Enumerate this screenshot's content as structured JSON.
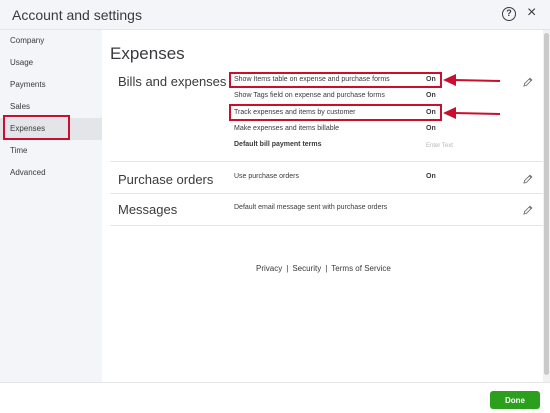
{
  "window": {
    "title": "Account and settings",
    "help_glyph": "?",
    "close_glyph": "×"
  },
  "sidebar": {
    "items": [
      {
        "label": "Company"
      },
      {
        "label": "Usage"
      },
      {
        "label": "Payments"
      },
      {
        "label": "Sales"
      },
      {
        "label": "Expenses"
      },
      {
        "label": "Time"
      },
      {
        "label": "Advanced"
      }
    ],
    "active": "Expenses"
  },
  "main": {
    "page_title": "Expenses",
    "bills": {
      "title": "Bills and expenses",
      "rows": [
        {
          "label": "Show Items table on expense and purchase forms",
          "value": "On"
        },
        {
          "label": "Show Tags field on expense and purchase forms",
          "value": "On"
        },
        {
          "label": "Track expenses and items by customer",
          "value": "On"
        },
        {
          "label": "Make expenses and items billable",
          "value": "On"
        },
        {
          "label": "Default bill payment terms",
          "placeholder": "Enter Text"
        }
      ]
    },
    "purchase_orders": {
      "title": "Purchase orders",
      "rows": [
        {
          "label": "Use purchase orders",
          "value": "On"
        }
      ]
    },
    "messages": {
      "title": "Messages",
      "rows": [
        {
          "label": "Default email message sent with purchase orders"
        }
      ]
    }
  },
  "footer": {
    "links": [
      "Privacy",
      "Security",
      "Terms of Service"
    ],
    "separator": "|"
  },
  "actions": {
    "done_label": "Done"
  },
  "colors": {
    "highlight": "#c8102e",
    "done": "#2ca01c",
    "sidebar_bg": "#f4f5f8"
  }
}
